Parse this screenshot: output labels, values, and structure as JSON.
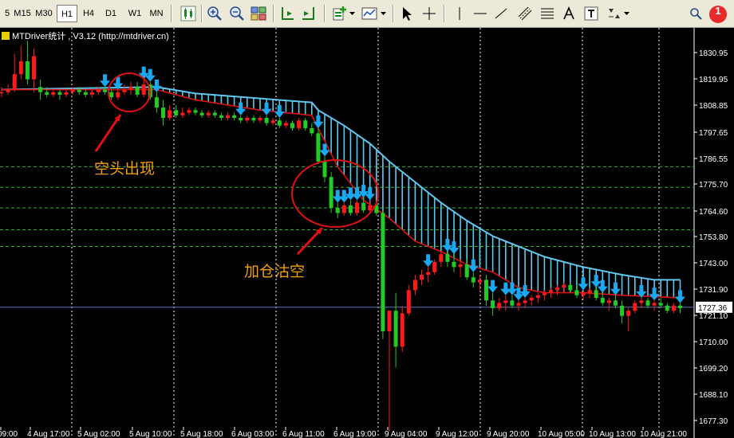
{
  "toolbar": {
    "timeframes": [
      "5",
      "M15",
      "M30",
      "H1",
      "H4",
      "D1",
      "W1",
      "MN"
    ],
    "active": "H1",
    "alert_badge": "1"
  },
  "indicator_label": "MTDriver统计 , V3.12 (http://mtdriver.cn)",
  "current_price": "1727.36",
  "colors": {
    "background": "#000000",
    "bull": "#ff1a1a",
    "bear": "#22cc22",
    "cloud": "#5ec8f0",
    "ma": "#e01010",
    "arrow": "#19a9f0",
    "annotation_text": "#f0a000",
    "annotation_circle": "#e01010",
    "level_lines": "#2db52d",
    "price_line": "#5a79c8"
  },
  "chart_data": {
    "type": "candlestick",
    "y_ticks": [
      "1830.95",
      "1819.95",
      "1808.85",
      "1797.65",
      "1786.55",
      "1775.70",
      "1764.60",
      "1753.80",
      "1743.00",
      "1731.90",
      "1721.10",
      "1710.00",
      "1699.20",
      "1688.10",
      "1677.30"
    ],
    "x_ticks": [
      "09:00",
      "4 Aug 17:00",
      "5 Aug 02:00",
      "5 Aug 10:00",
      "5 Aug 18:00",
      "6 Aug 03:00",
      "6 Aug 11:00",
      "6 Aug 19:00",
      "9 Aug 04:00",
      "9 Aug 12:00",
      "9 Aug 20:00",
      "10 Aug 05:00",
      "10 Aug 13:00",
      "10 Aug 21:00"
    ],
    "ylim": [
      1676.5,
      1836
    ],
    "level_lines": [
      1782,
      1774,
      1766,
      1757.5,
      1751
    ],
    "current_price": 1727.36,
    "annotations": [
      "空头出现",
      "加仓沽空"
    ],
    "candles": [
      [
        1811,
        1813,
        1809,
        1811
      ],
      [
        1811,
        1814,
        1810,
        1812
      ],
      [
        1812,
        1826,
        1811,
        1818
      ],
      [
        1818,
        1829,
        1816,
        1823
      ],
      [
        1823,
        1831,
        1814,
        1816
      ],
      [
        1816,
        1828,
        1811,
        1825
      ],
      [
        1813,
        1816,
        1808,
        1811
      ],
      [
        1811,
        1813,
        1809,
        1810
      ],
      [
        1810,
        1812,
        1809,
        1811
      ],
      [
        1811,
        1812,
        1808,
        1810
      ],
      [
        1810,
        1812,
        1809,
        1811
      ],
      [
        1811,
        1813,
        1810,
        1812
      ],
      [
        1812,
        1813,
        1810,
        1811
      ],
      [
        1811,
        1812,
        1809,
        1810
      ],
      [
        1810,
        1812,
        1809,
        1811
      ],
      [
        1811,
        1813,
        1810,
        1812
      ],
      [
        1812,
        1813,
        1810,
        1811
      ],
      [
        1811,
        1812,
        1808,
        1809
      ],
      [
        1809,
        1812,
        1808,
        1811
      ],
      [
        1811,
        1814,
        1810,
        1812
      ],
      [
        1812,
        1815,
        1810,
        1813
      ],
      [
        1813,
        1815,
        1809,
        1810
      ],
      [
        1810,
        1816,
        1809,
        1814
      ],
      [
        1814,
        1815,
        1808,
        1809
      ],
      [
        1809,
        1811,
        1803,
        1805
      ],
      [
        1805,
        1808,
        1798,
        1801
      ],
      [
        1801,
        1806,
        1800,
        1804
      ],
      [
        1804,
        1806,
        1801,
        1802
      ],
      [
        1802,
        1805,
        1801,
        1803
      ],
      [
        1803,
        1805,
        1802,
        1804
      ],
      [
        1804,
        1805,
        1802,
        1803
      ],
      [
        1803,
        1804,
        1801,
        1802
      ],
      [
        1802,
        1804,
        1801,
        1803
      ],
      [
        1803,
        1804,
        1801,
        1802
      ],
      [
        1802,
        1803,
        1800,
        1801
      ],
      [
        1801,
        1803,
        1800,
        1802
      ],
      [
        1802,
        1803,
        1800,
        1801
      ],
      [
        1801,
        1802,
        1799,
        1800
      ],
      [
        1800,
        1802,
        1799,
        1801
      ],
      [
        1801,
        1802,
        1799,
        1800
      ],
      [
        1800,
        1802,
        1799,
        1801
      ],
      [
        1801,
        1802,
        1798,
        1799
      ],
      [
        1799,
        1801,
        1798,
        1800
      ],
      [
        1800,
        1801,
        1797,
        1798
      ],
      [
        1798,
        1800,
        1797,
        1799
      ],
      [
        1799,
        1800,
        1796,
        1797
      ],
      [
        1797,
        1801,
        1796,
        1800
      ],
      [
        1800,
        1801,
        1796,
        1797
      ],
      [
        1797,
        1799,
        1794,
        1795
      ],
      [
        1795,
        1797,
        1783,
        1784
      ],
      [
        1784,
        1786,
        1776,
        1778
      ],
      [
        1778,
        1780,
        1764,
        1766
      ],
      [
        1766,
        1768,
        1762,
        1764
      ],
      [
        1764,
        1768,
        1763,
        1767
      ],
      [
        1767,
        1769,
        1763,
        1764
      ],
      [
        1764,
        1769,
        1763,
        1768
      ],
      [
        1768,
        1770,
        1764,
        1765
      ],
      [
        1765,
        1769,
        1764,
        1767
      ],
      [
        1767,
        1768,
        1763,
        1764
      ],
      [
        1764,
        1765,
        1715,
        1718
      ],
      [
        1718,
        1722,
        1679,
        1726
      ],
      [
        1726,
        1733,
        1704,
        1712
      ],
      [
        1712,
        1728,
        1710,
        1725
      ],
      [
        1725,
        1736,
        1724,
        1734
      ],
      [
        1734,
        1740,
        1732,
        1738
      ],
      [
        1738,
        1742,
        1736,
        1740
      ],
      [
        1740,
        1743,
        1737,
        1741
      ],
      [
        1741,
        1746,
        1740,
        1745
      ],
      [
        1745,
        1749,
        1743,
        1748
      ],
      [
        1748,
        1749,
        1743,
        1745
      ],
      [
        1745,
        1748,
        1741,
        1743
      ],
      [
        1743,
        1746,
        1739,
        1744
      ],
      [
        1744,
        1746,
        1738,
        1739
      ],
      [
        1739,
        1741,
        1735,
        1737
      ],
      [
        1737,
        1740,
        1734,
        1738
      ],
      [
        1738,
        1740,
        1728,
        1730
      ],
      [
        1730,
        1733,
        1724,
        1727
      ],
      [
        1727,
        1731,
        1726,
        1729
      ],
      [
        1729,
        1732,
        1726,
        1730
      ],
      [
        1730,
        1732,
        1727,
        1728
      ],
      [
        1728,
        1730,
        1726,
        1729
      ],
      [
        1729,
        1731,
        1727,
        1730
      ],
      [
        1730,
        1732,
        1728,
        1731
      ],
      [
        1731,
        1733,
        1729,
        1732
      ],
      [
        1732,
        1734,
        1730,
        1733
      ],
      [
        1733,
        1735,
        1731,
        1734
      ],
      [
        1734,
        1736,
        1732,
        1735
      ],
      [
        1735,
        1737,
        1733,
        1736
      ],
      [
        1736,
        1737,
        1733,
        1734
      ],
      [
        1734,
        1736,
        1731,
        1732
      ],
      [
        1732,
        1734,
        1730,
        1733
      ],
      [
        1733,
        1735,
        1731,
        1734
      ],
      [
        1734,
        1735,
        1730,
        1731
      ],
      [
        1731,
        1733,
        1728,
        1729
      ],
      [
        1729,
        1731,
        1726,
        1730
      ],
      [
        1730,
        1732,
        1727,
        1728
      ],
      [
        1728,
        1730,
        1721,
        1724
      ],
      [
        1724,
        1727,
        1718,
        1726
      ],
      [
        1726,
        1730,
        1725,
        1729
      ],
      [
        1729,
        1731,
        1727,
        1730
      ],
      [
        1730,
        1731,
        1727,
        1728
      ],
      [
        1728,
        1730,
        1726,
        1729
      ],
      [
        1729,
        1731,
        1727,
        1728
      ],
      [
        1728,
        1729,
        1725,
        1726
      ],
      [
        1726,
        1729,
        1725,
        1728
      ],
      [
        1728,
        1729,
        1725,
        1727
      ]
    ],
    "cloud_upper": [
      [
        0,
        1812
      ],
      [
        24,
        1813
      ],
      [
        30,
        1810.5
      ],
      [
        48,
        1807
      ],
      [
        49,
        1804
      ],
      [
        53,
        1798
      ],
      [
        57,
        1791
      ],
      [
        60,
        1784
      ],
      [
        64,
        1776
      ],
      [
        68,
        1768
      ],
      [
        72,
        1761
      ],
      [
        76,
        1755
      ],
      [
        80,
        1751
      ],
      [
        84,
        1747
      ],
      [
        90,
        1743
      ],
      [
        96,
        1740
      ],
      [
        101,
        1738
      ],
      [
        105,
        1738
      ]
    ],
    "ma_line": [
      [
        0,
        1812
      ],
      [
        24,
        1812
      ],
      [
        30,
        1808
      ],
      [
        40,
        1804
      ],
      [
        48,
        1802
      ],
      [
        52,
        1782
      ],
      [
        56,
        1769
      ],
      [
        60,
        1762
      ],
      [
        64,
        1753
      ],
      [
        68,
        1749
      ],
      [
        72,
        1744
      ],
      [
        76,
        1741
      ],
      [
        80,
        1735
      ],
      [
        84,
        1733
      ],
      [
        90,
        1733
      ],
      [
        96,
        1732
      ],
      [
        101,
        1731.5
      ],
      [
        105,
        1731
      ]
    ],
    "arrows": [
      16,
      18,
      22,
      23,
      24,
      37,
      41,
      43,
      49,
      50,
      52,
      53,
      54,
      55,
      56,
      57,
      66,
      69,
      70,
      73,
      76,
      78,
      79,
      80,
      81,
      90,
      92,
      93,
      95,
      99,
      101,
      105
    ]
  }
}
